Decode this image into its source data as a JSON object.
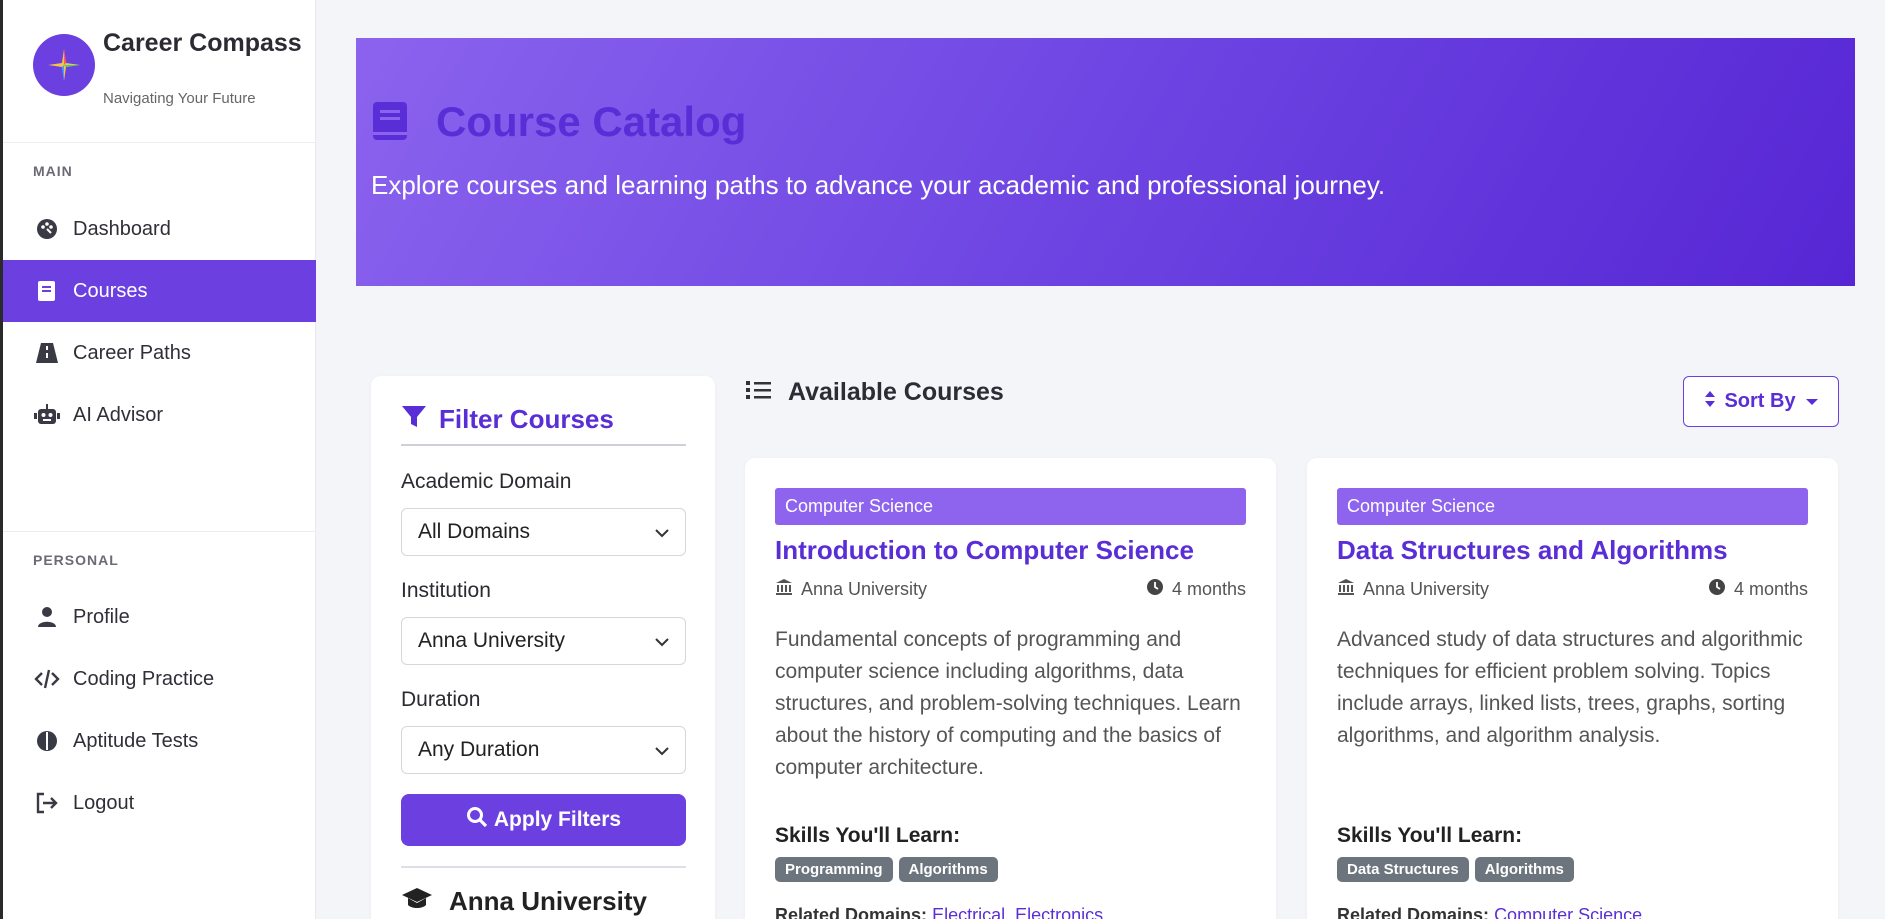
{
  "brand": {
    "name": "Career Compass",
    "tagline": "Navigating Your Future"
  },
  "sidebar": {
    "main_label": "MAIN",
    "personal_label": "PERSONAL",
    "main_items": [
      {
        "label": "Dashboard",
        "icon": "palette-icon",
        "active": false
      },
      {
        "label": "Courses",
        "icon": "book-icon",
        "active": true
      },
      {
        "label": "Career Paths",
        "icon": "road-icon",
        "active": false
      },
      {
        "label": "AI Advisor",
        "icon": "robot-icon",
        "active": false
      }
    ],
    "personal_items": [
      {
        "label": "Profile",
        "icon": "user-icon"
      },
      {
        "label": "Coding Practice",
        "icon": "code-icon"
      },
      {
        "label": "Aptitude Tests",
        "icon": "brain-icon"
      },
      {
        "label": "Logout",
        "icon": "logout-icon"
      }
    ]
  },
  "hero": {
    "title": "Course Catalog",
    "subtitle": "Explore courses and learning paths to advance your academic and professional journey."
  },
  "filter": {
    "title": "Filter Courses",
    "domain_label": "Academic Domain",
    "domain_value": "All Domains",
    "institution_label": "Institution",
    "institution_value": "Anna University",
    "duration_label": "Duration",
    "duration_value": "Any Duration",
    "apply_label": "Apply Filters",
    "institution_heading": "Anna University"
  },
  "courses_section": {
    "title": "Available Courses",
    "sort_label": "Sort By"
  },
  "courses": [
    {
      "domain": "Computer Science",
      "title": "Introduction to Computer Science",
      "institution": "Anna University",
      "duration": "4 months",
      "description": "Fundamental concepts of programming and computer science including algorithms, data structures, and problem-solving techniques. Learn about the history of computing and the basics of computer architecture.",
      "skills_label": "Skills You'll Learn:",
      "skills": [
        "Programming",
        "Algorithms"
      ],
      "related_label": "Related Domains:",
      "related": [
        "Electrical",
        "Electronics"
      ]
    },
    {
      "domain": "Computer Science",
      "title": "Data Structures and Algorithms",
      "institution": "Anna University",
      "duration": "4 months",
      "description": "Advanced study of data structures and algorithmic techniques for efficient problem solving. Topics include arrays, linked lists, trees, graphs, sorting algorithms, and algorithm analysis.",
      "skills_label": "Skills You'll Learn:",
      "skills": [
        "Data Structures",
        "Algorithms"
      ],
      "related_label": "Related Domains:",
      "related": [
        "Computer Science"
      ]
    }
  ],
  "colors": {
    "accent": "#6b3fe0",
    "accent_dark": "#5a2ed6",
    "badge": "#6c757d"
  }
}
